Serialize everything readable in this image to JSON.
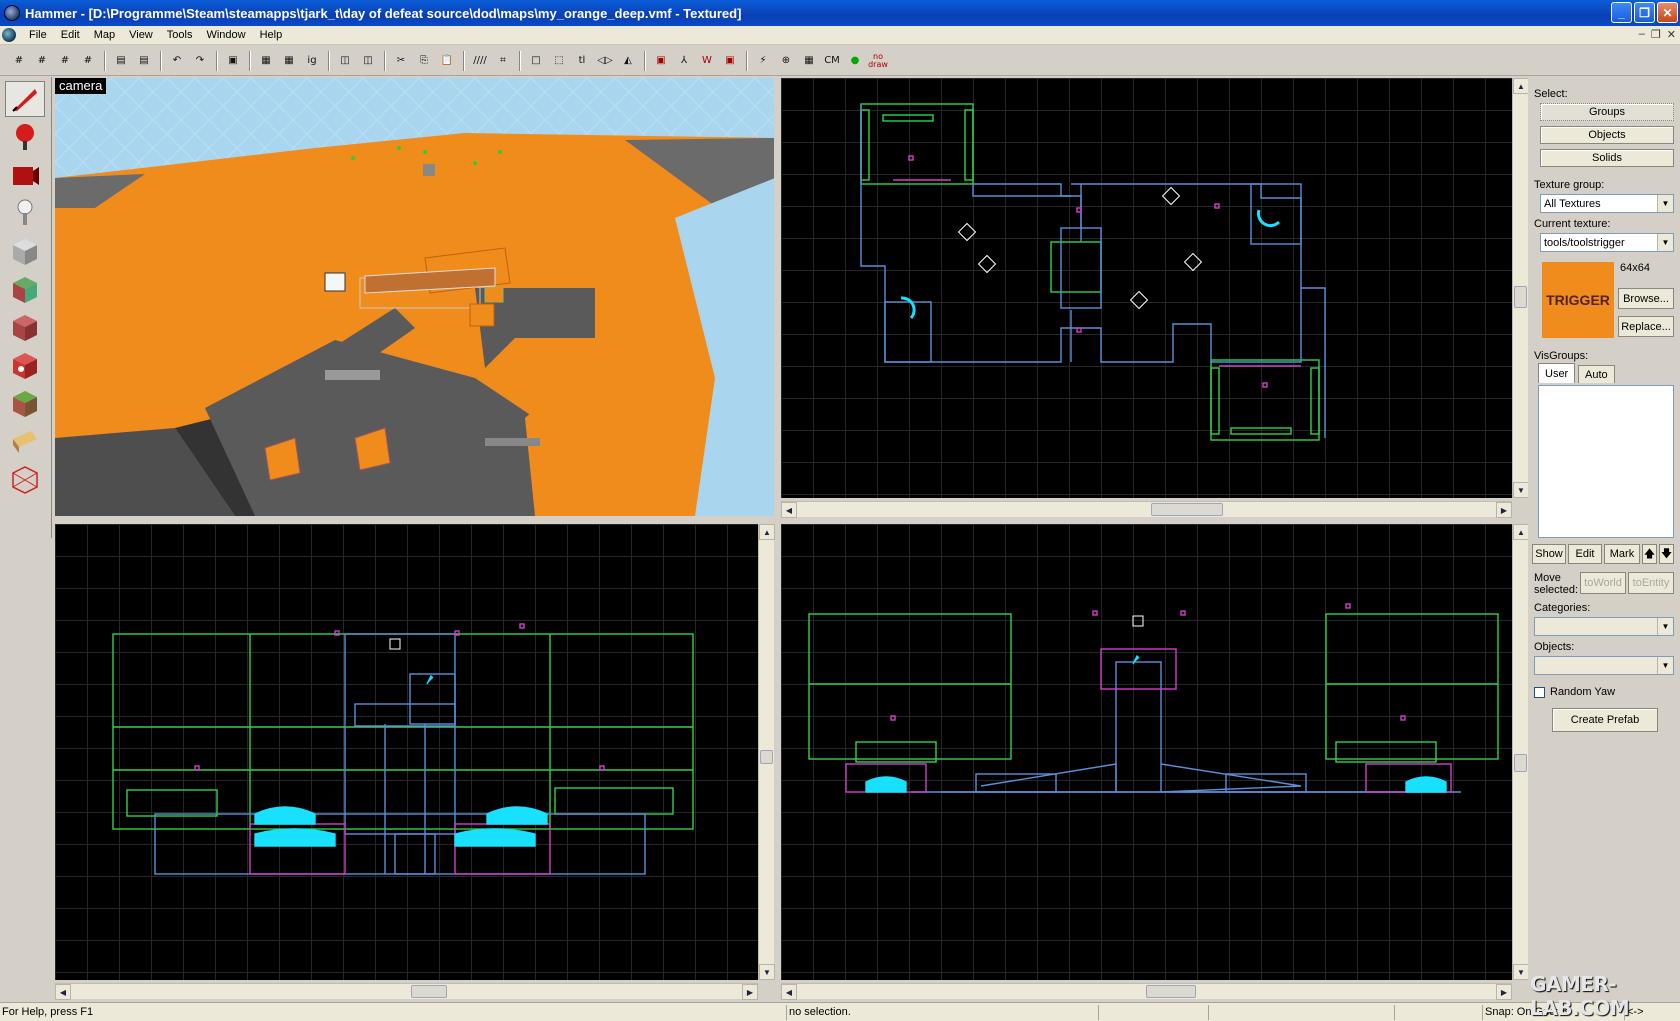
{
  "window": {
    "title": "Hammer - [D:\\Programme\\Steam\\steamapps\\tjark_t\\day of defeat source\\dod\\maps\\my_orange_deep.vmf - Textured]"
  },
  "menu": [
    "File",
    "Edit",
    "Map",
    "View",
    "Tools",
    "Window",
    "Help"
  ],
  "toolbar": {
    "text_buttons": {
      "ig": "ig",
      "tl": "tl",
      "cm": "CM",
      "no_draw": "no draw"
    }
  },
  "viewports": {
    "camera_label": "camera"
  },
  "right_panel": {
    "select_label": "Select:",
    "groups_button": "Groups",
    "objects_button": "Objects",
    "solids_button": "Solids",
    "texture_group_label": "Texture group:",
    "texture_group_value": "All Textures",
    "current_texture_label": "Current texture:",
    "current_texture_value": "tools/toolstrigger",
    "texture_thumb_label": "TRIGGER",
    "texture_size": "64x64",
    "browse_button": "Browse...",
    "replace_button": "Replace...",
    "visgroups_label": "VisGroups:",
    "tab_user": "User",
    "tab_auto": "Auto",
    "show_button": "Show",
    "edit_button": "Edit",
    "mark_button": "Mark",
    "move_selected_label_1": "Move",
    "move_selected_label_2": "selected:",
    "to_world_button": "toWorld",
    "to_entity_button": "toEntity",
    "categories_label": "Categories:",
    "objects_label": "Objects:",
    "random_yaw_label": "Random Yaw",
    "create_prefab_button": "Create Prefab"
  },
  "status": {
    "help_text": "For Help, press F1",
    "selection_text": "no selection.",
    "snap_text": "Snap: On Grid: 8",
    "extra_text": "<->"
  },
  "watermark": "GAMER-LAB.COM",
  "colors": {
    "title_blue": "#0a49c4",
    "orange_ground": "#f08c1c",
    "wire_green": "#2fd34c",
    "wire_blue": "#5a8fd8",
    "wire_cyan": "#18e0ff",
    "wire_magenta": "#d040c8"
  }
}
